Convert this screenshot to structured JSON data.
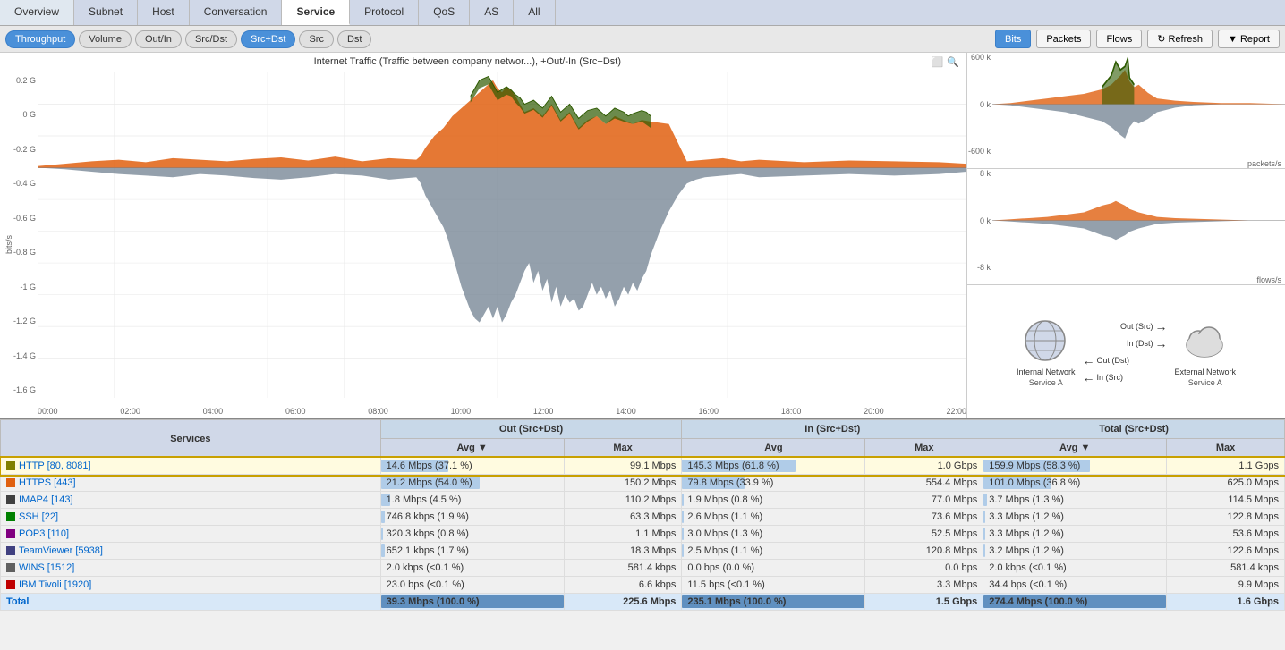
{
  "nav": {
    "tabs": [
      {
        "label": "Overview",
        "active": false
      },
      {
        "label": "Subnet",
        "active": false
      },
      {
        "label": "Host",
        "active": false
      },
      {
        "label": "Conversation",
        "active": false
      },
      {
        "label": "Service",
        "active": true
      },
      {
        "label": "Protocol",
        "active": false
      },
      {
        "label": "QoS",
        "active": false
      },
      {
        "label": "AS",
        "active": false
      },
      {
        "label": "All",
        "active": false
      }
    ]
  },
  "toolbar": {
    "left_buttons": [
      {
        "label": "Throughput",
        "active": true
      },
      {
        "label": "Volume",
        "active": false
      },
      {
        "label": "Out/In",
        "active": false
      },
      {
        "label": "Src/Dst",
        "active": false
      },
      {
        "label": "Src+Dst",
        "active": true
      },
      {
        "label": "Src",
        "active": false
      },
      {
        "label": "Dst",
        "active": false
      }
    ],
    "right_buttons": [
      {
        "label": "Bits",
        "active": true
      },
      {
        "label": "Packets",
        "active": false
      },
      {
        "label": "Flows",
        "active": false
      }
    ],
    "refresh_label": "Refresh",
    "report_label": "Report"
  },
  "chart": {
    "title": "Internet Traffic (Traffic between company networ...), +Out/-In (Src+Dst)",
    "y_labels": [
      "0.2 G",
      "0 G",
      "-0.2 G",
      "-0.4 G",
      "-0.6 G",
      "-0.8 G",
      "-1 G",
      "-1.2 G",
      "-1.4 G",
      "-1.6 G"
    ],
    "x_labels": [
      "00:00",
      "02:00",
      "04:00",
      "06:00",
      "08:00",
      "10:00",
      "12:00",
      "14:00",
      "16:00",
      "18:00",
      "20:00",
      "22:00"
    ],
    "bits_label": "bits/s"
  },
  "mini_charts": {
    "packets": {
      "y_top": "600 k",
      "y_mid": "0 k",
      "y_bot": "-600 k",
      "x_label": "packets/s"
    },
    "flows": {
      "y_top": "8 k",
      "y_mid": "0 k",
      "y_bot": "-8 k",
      "x_label": "flows/s"
    }
  },
  "diagram": {
    "internal_label": "Internal Network",
    "external_label": "External Network",
    "service_a_left": "Service A",
    "service_a_right": "Service A",
    "out_src": "Out (Src)",
    "in_dst": "In (Dst)",
    "out_dst": "Out (Dst)",
    "in_src": "In (Src)"
  },
  "table": {
    "headers": {
      "services": "Services",
      "out_group": "Out (Src+Dst)",
      "in_group": "In (Src+Dst)",
      "total_group": "Total (Src+Dst)",
      "avg": "Avg",
      "max": "Max"
    },
    "rows": [
      {
        "name": "HTTP [80, 8081]",
        "color": "#808000",
        "selected": true,
        "out_avg": "14.6 Mbps (37.1 %)",
        "out_avg_pct": 37,
        "out_max": "99.1 Mbps",
        "in_avg": "145.3 Mbps (61.8 %)",
        "in_avg_pct": 62,
        "in_max": "1.0 Gbps",
        "total_avg": "159.9 Mbps (58.3 %)",
        "total_avg_pct": 58,
        "total_max": "1.1 Gbps"
      },
      {
        "name": "HTTPS [443]",
        "color": "#e06010",
        "selected": false,
        "out_avg": "21.2 Mbps (54.0 %)",
        "out_avg_pct": 54,
        "out_max": "150.2 Mbps",
        "in_avg": "79.8 Mbps (33.9 %)",
        "in_avg_pct": 34,
        "in_max": "554.4 Mbps",
        "total_avg": "101.0 Mbps (36.8 %)",
        "total_avg_pct": 37,
        "total_max": "625.0 Mbps"
      },
      {
        "name": "IMAP4 [143]",
        "color": "#404040",
        "selected": false,
        "out_avg": "1.8 Mbps (4.5 %)",
        "out_avg_pct": 5,
        "out_max": "110.2 Mbps",
        "in_avg": "1.9 Mbps (0.8 %)",
        "in_avg_pct": 1,
        "in_max": "77.0 Mbps",
        "total_avg": "3.7 Mbps (1.3 %)",
        "total_avg_pct": 2,
        "total_max": "114.5 Mbps"
      },
      {
        "name": "SSH [22]",
        "color": "#008000",
        "selected": false,
        "out_avg": "746.8 kbps (1.9 %)",
        "out_avg_pct": 2,
        "out_max": "63.3 Mbps",
        "in_avg": "2.6 Mbps (1.1 %)",
        "in_avg_pct": 1,
        "in_max": "73.6 Mbps",
        "total_avg": "3.3 Mbps (1.2 %)",
        "total_avg_pct": 1,
        "total_max": "122.8 Mbps"
      },
      {
        "name": "POP3 [110]",
        "color": "#800080",
        "selected": false,
        "out_avg": "320.3 kbps (0.8 %)",
        "out_avg_pct": 1,
        "out_max": "1.1 Mbps",
        "in_avg": "3.0 Mbps (1.3 %)",
        "in_avg_pct": 1,
        "in_max": "52.5 Mbps",
        "total_avg": "3.3 Mbps (1.2 %)",
        "total_avg_pct": 1,
        "total_max": "53.6 Mbps"
      },
      {
        "name": "TeamViewer [5938]",
        "color": "#404080",
        "selected": false,
        "out_avg": "652.1 kbps (1.7 %)",
        "out_avg_pct": 2,
        "out_max": "18.3 Mbps",
        "in_avg": "2.5 Mbps (1.1 %)",
        "in_avg_pct": 1,
        "in_max": "120.8 Mbps",
        "total_avg": "3.2 Mbps (1.2 %)",
        "total_avg_pct": 1,
        "total_max": "122.6 Mbps"
      },
      {
        "name": "WINS [1512]",
        "color": "#606060",
        "selected": false,
        "out_avg": "2.0 kbps (<0.1 %)",
        "out_avg_pct": 0,
        "out_max": "581.4 kbps",
        "in_avg": "0.0 bps (0.0 %)",
        "in_avg_pct": 0,
        "in_max": "0.0 bps",
        "total_avg": "2.0 kbps (<0.1 %)",
        "total_avg_pct": 0,
        "total_max": "581.4 kbps"
      },
      {
        "name": "IBM Tivoli [1920]",
        "color": "#c00000",
        "selected": false,
        "out_avg": "23.0 bps (<0.1 %)",
        "out_avg_pct": 0,
        "out_max": "6.6 kbps",
        "in_avg": "11.5 bps (<0.1 %)",
        "in_avg_pct": 0,
        "in_max": "3.3 Mbps",
        "total_avg": "34.4 bps (<0.1 %)",
        "total_avg_pct": 0,
        "total_max": "9.9 Mbps"
      },
      {
        "name": "Total",
        "color": null,
        "selected": false,
        "is_total": true,
        "out_avg": "39.3 Mbps (100.0 %)",
        "out_avg_pct": 100,
        "out_max": "225.6 Mbps",
        "in_avg": "235.1 Mbps (100.0 %)",
        "in_avg_pct": 100,
        "in_max": "1.5 Gbps",
        "total_avg": "274.4 Mbps (100.0 %)",
        "total_avg_pct": 100,
        "total_max": "1.6 Gbps"
      }
    ]
  }
}
